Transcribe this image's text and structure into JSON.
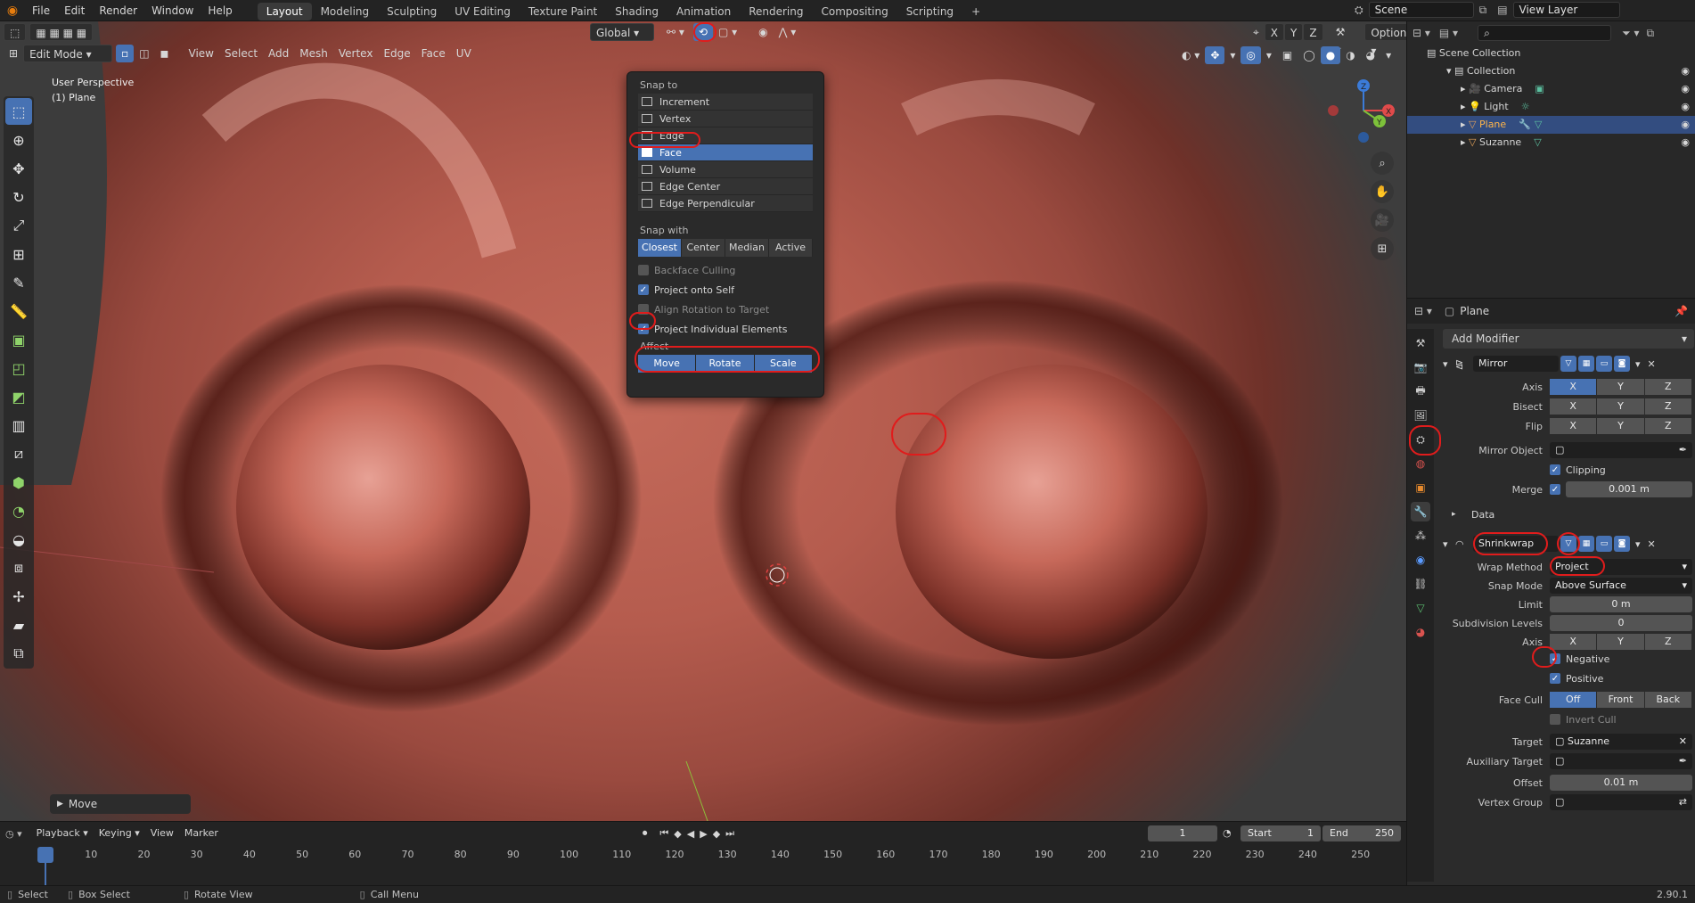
{
  "topbar": {
    "menus": [
      "File",
      "Edit",
      "Render",
      "Window",
      "Help"
    ],
    "workspaces": [
      "Layout",
      "Modeling",
      "Sculpting",
      "UV Editing",
      "Texture Paint",
      "Shading",
      "Animation",
      "Rendering",
      "Compositing",
      "Scripting"
    ],
    "add_tab": "+",
    "scene": "Scene",
    "view_layer": "View Layer"
  },
  "viewport_header": {
    "mode": "Edit Mode",
    "menus": [
      "View",
      "Select",
      "Add",
      "Mesh",
      "Vertex",
      "Edge",
      "Face",
      "UV"
    ],
    "transform_orientation": "Global",
    "options": "Options",
    "axes": [
      "X",
      "Y",
      "Z"
    ]
  },
  "viewport": {
    "perspective": "User Perspective",
    "object": "(1) Plane",
    "last_op": "Move"
  },
  "snap_popup": {
    "title": "Snap to",
    "items": [
      "Increment",
      "Vertex",
      "Edge",
      "Face",
      "Volume",
      "Edge Center",
      "Edge Perpendicular"
    ],
    "selected": "Face",
    "snap_with_title": "Snap with",
    "snap_with": [
      "Closest",
      "Center",
      "Median",
      "Active"
    ],
    "snap_with_selected": "Closest",
    "backface": "Backface Culling",
    "project_self": "Project onto Self",
    "align_rot": "Align Rotation to Target",
    "project_individual": "Project Individual Elements",
    "affect_title": "Affect",
    "affect": [
      "Move",
      "Rotate",
      "Scale"
    ]
  },
  "outliner": {
    "root": "Scene Collection",
    "collection": "Collection",
    "objects": [
      "Camera",
      "Light",
      "Plane",
      "Suzanne"
    ],
    "selected": "Plane"
  },
  "properties": {
    "object_name": "Plane",
    "add_modifier": "Add Modifier",
    "mirror": {
      "name": "Mirror",
      "axis_label": "Axis",
      "bisect_label": "Bisect",
      "flip_label": "Flip",
      "mirror_object_label": "Mirror Object",
      "clipping": "Clipping",
      "merge_label": "Merge",
      "merge_value": "0.001 m",
      "data": "Data"
    },
    "shrinkwrap": {
      "name": "Shrinkwrap",
      "wrap_method_label": "Wrap Method",
      "wrap_method": "Project",
      "snap_mode_label": "Snap Mode",
      "snap_mode": "Above Surface",
      "limit_label": "Limit",
      "limit": "0 m",
      "subdiv_label": "Subdivision Levels",
      "subdiv": "0",
      "axis_label": "Axis",
      "negative": "Negative",
      "positive": "Positive",
      "face_cull_label": "Face Cull",
      "face_cull": [
        "Off",
        "Front",
        "Back"
      ],
      "invert_cull": "Invert Cull",
      "target_label": "Target",
      "target": "Suzanne",
      "aux_target_label": "Auxiliary Target",
      "offset_label": "Offset",
      "offset": "0.01 m",
      "vertex_group_label": "Vertex Group"
    }
  },
  "timeline": {
    "menus": [
      "Playback",
      "Keying",
      "View",
      "Marker"
    ],
    "current_frame": "1",
    "start_label": "Start",
    "start": "1",
    "end_label": "End",
    "end": "250",
    "ticks": [
      "1",
      "10",
      "20",
      "30",
      "40",
      "50",
      "60",
      "70",
      "80",
      "90",
      "100",
      "110",
      "120",
      "130",
      "140",
      "150",
      "160",
      "170",
      "180",
      "190",
      "200",
      "210",
      "220",
      "230",
      "240",
      "250"
    ]
  },
  "statusbar": {
    "select": "Select",
    "box_select": "Box Select",
    "rotate_view": "Rotate View",
    "call_menu": "Call Menu",
    "version": "2.90.1"
  }
}
